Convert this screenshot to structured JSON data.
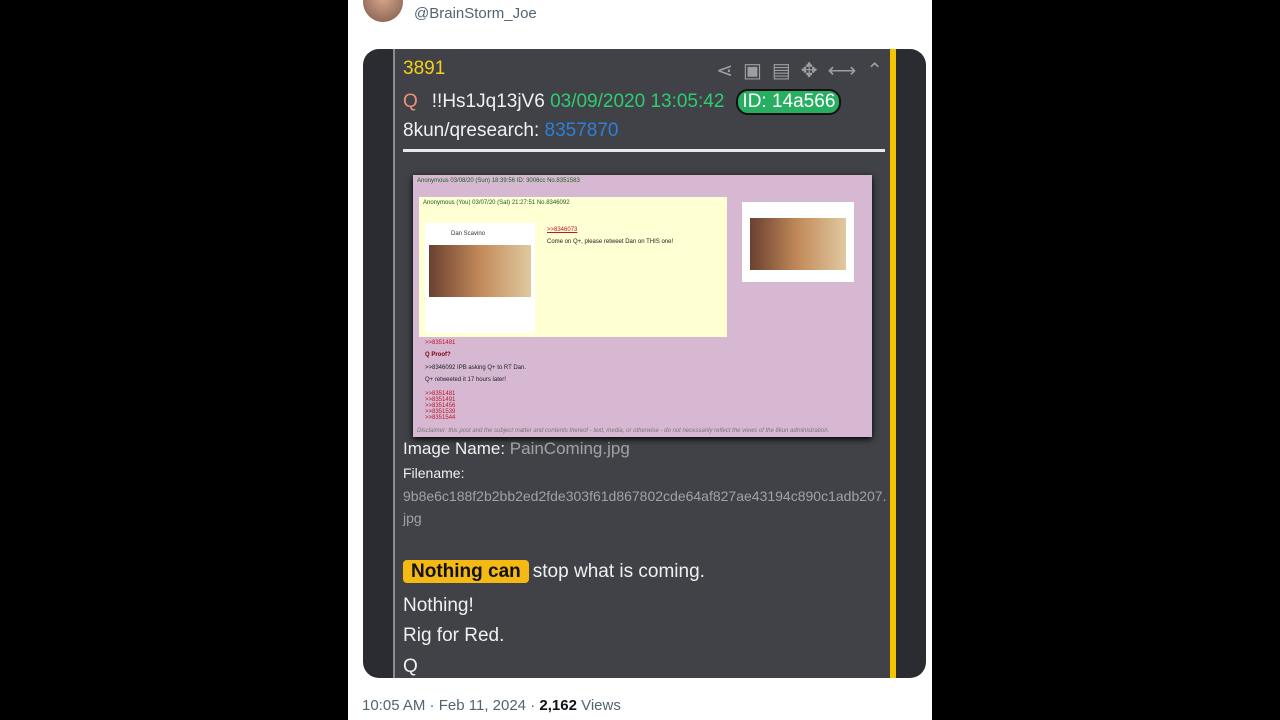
{
  "tweet": {
    "handle": "@BrainStorm_Joe",
    "time": "10:05 AM",
    "sep": " · ",
    "date": "Feb 11, 2024",
    "views": "2,162",
    "views_label": " Views"
  },
  "post": {
    "number": "3891",
    "icons": [
      "share-icon",
      "clipboard-check-icon",
      "image-file-icon",
      "move-icon",
      "arrows-horizontal-icon",
      "chevron-up-circle-icon"
    ],
    "author": "Q",
    "trip": "!!Hs1Jq13jV6",
    "datetime": "03/09/2020 13:05:42",
    "id": "ID: 14a566",
    "board": "8kun/qresearch:",
    "post_link": "8357870",
    "image_name_label": "Image Name:",
    "image_name": "PainComing.jpg",
    "filename_label": "Filename:",
    "filename": "9b8e6c188f2b2bb2ed2fde303f61d867802cde64af827ae43194c890c1adb207.jpg",
    "highlight": "Nothing can",
    "line1": "stop what is coming.",
    "line2": "Nothing!",
    "line3": "Rig for Red.",
    "line4": "Q"
  },
  "embedded": {
    "header": "Anonymous 03/08/20 (Sun) 18:39:56 ID: 3006cc No.8351583",
    "reply_header": "Anonymous (You) 03/07/20 (Sat) 21:27:51 No.8346092",
    "tweet_name": "Dan Scavino",
    "comment": "Come on Q+, please retweet Dan on THIS one!",
    "link0": ">>8346073",
    "link1": ">>8351481",
    "proof": "Q Proof?",
    "ask": ">>8346092 IPB asking Q+ to RT Dan.",
    "retweet": "Q+ retweeted it 17 hours later!",
    "links": [
      ">>8351481",
      ">>8351491",
      ">>8351456",
      ">>8351539",
      ">>8351544"
    ],
    "disclaimer": "Disclaimer: this post and the subject matter and contents thereof - text, media, or otherwise - do not necessarily reflect the views of the 8kun administration.",
    "colors": {
      "bg": "#d6b8d2",
      "reply": "#ffffd4"
    }
  },
  "colors": {
    "accent_bar": "#f5c400",
    "number": "#f2d21b",
    "date": "#2ecc71",
    "link": "#2f7fd8",
    "highlight": "#f5b914"
  }
}
